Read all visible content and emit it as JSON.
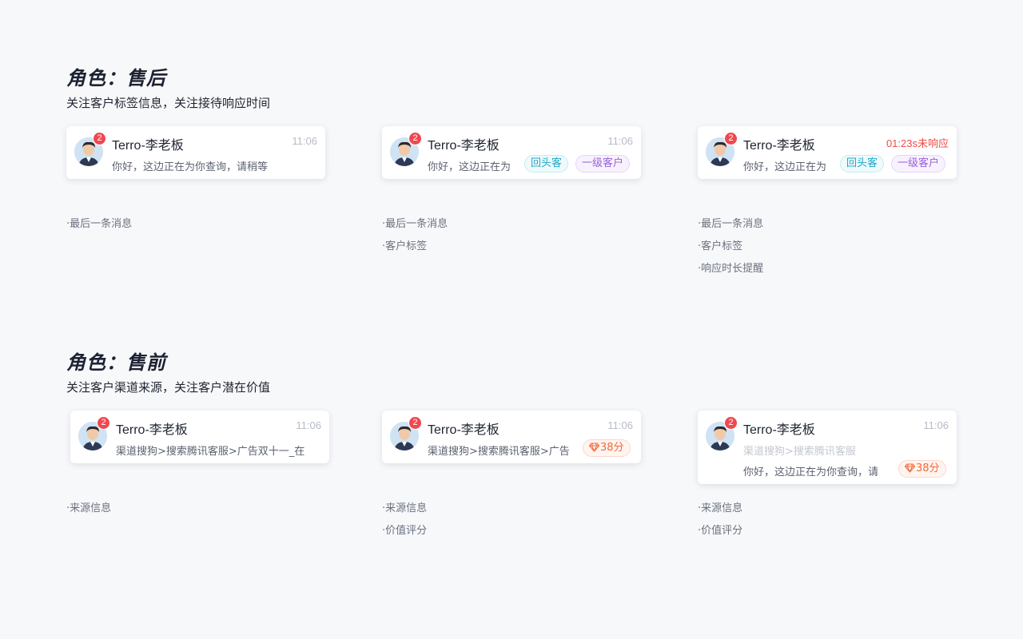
{
  "sections": [
    {
      "title": "角色：售后",
      "desc": "关注客户标签信息，关注接待响应时间",
      "cards": [
        {
          "badge": "2",
          "name": "Terro-李老板",
          "time": "11:06",
          "message": "你好，这边正在为你查询，请稍等",
          "notes": [
            "·最后一条消息"
          ]
        },
        {
          "badge": "2",
          "name": "Terro-李老板",
          "time": "11:06",
          "message": "你好，这边正在为",
          "tags": [
            "回头客",
            "一级客户"
          ],
          "notes": [
            "·最后一条消息",
            "·客户标签"
          ]
        },
        {
          "badge": "2",
          "name": "Terro-李老板",
          "time": "01:23s未响应",
          "message": "你好，这边正在为",
          "tags": [
            "回头客",
            "一级客户"
          ],
          "notes": [
            "·最后一条消息",
            "·客户标签",
            "·响应时长提醒"
          ]
        }
      ]
    },
    {
      "title": "角色：售前",
      "desc": "关注客户渠道来源，关注客户潜在价值",
      "cards": [
        {
          "badge": "2",
          "name": "Terro-李老板",
          "time": "11:06",
          "message": "渠道搜狗>搜索腾讯客服>广告双十一_在",
          "notes": [
            "·来源信息"
          ]
        },
        {
          "badge": "2",
          "name": "Terro-李老板",
          "time": "11:06",
          "message": "渠道搜狗>搜索腾讯客服>广告",
          "score": "38分",
          "notes": [
            "·来源信息",
            "·价值评分"
          ]
        },
        {
          "badge": "2",
          "name": "Terro-李老板",
          "time": "11:06",
          "source": "渠道搜狗>搜索腾讯客服",
          "message": "你好，这边正在为你查询，请",
          "score": "38分",
          "notes": [
            "·来源信息",
            "·价值评分"
          ]
        }
      ]
    }
  ],
  "colors": {
    "badge": "#f0484f",
    "alert_time": "#ef4b45",
    "tag_cyan": "#1fa8c4",
    "tag_purple": "#9a5fe0",
    "score_orange": "#f06a3c"
  },
  "icons": {
    "avatar": "person-avatar-icon",
    "score": "diamond-icon"
  }
}
